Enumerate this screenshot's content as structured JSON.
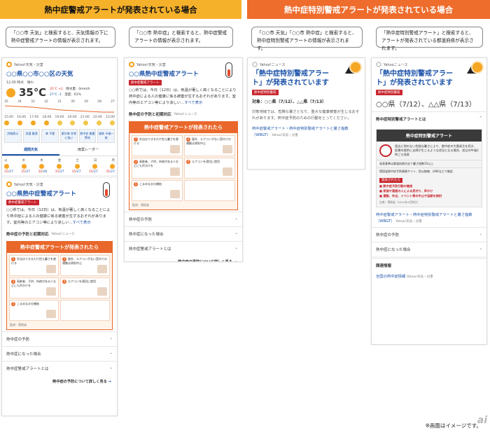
{
  "headers": {
    "left": "熱中症警戒アラートが発表されている場合",
    "right": "熱中症特別警戒アラートが発表されている場合"
  },
  "notes": {
    "n1": "「○○市 天気」と検索すると、天気情報の下に熱中症警戒アラートの情報が表示されます。",
    "n2": "「○○市 熱中症」と検索すると、熱中症警戒アラートの情報が表示されます。",
    "n3": "「○○市 天気」「○○市 熱中症」と検索すると、熱中症特別警戒アラートの情報が表示されます。",
    "n4": "「熱中症特別警戒アラート」と検索すると、アラートが発表されている都道府県が表示されます。"
  },
  "card1": {
    "source": "Yahoo!天気・災害",
    "title": "○○県○○市○○区の天気",
    "date": "12:00 時点　晴れ",
    "temp": "35℃",
    "hi": "35℃ +2",
    "lo": "27℃ -1",
    "rain": "降水量：0mm/h",
    "hum": "湿度：61%",
    "scale": [
      "35",
      "34",
      "33",
      "32",
      "31",
      "30",
      "29",
      "28",
      "27"
    ],
    "hours": [
      "15:00",
      "16:00",
      "17:00",
      "18:00",
      "19:00",
      "20:00",
      "21:00",
      "22:00",
      "23:00"
    ],
    "buttons": [
      "詳細表示",
      "洗濯 最適",
      "傘 不要",
      "紫外線 非常に強い",
      "熱中症 厳重警戒",
      "服装 半袖一枚"
    ],
    "tab1": "週間天気",
    "tab2": "雨雲レーダー",
    "days": [
      "火",
      "水",
      "木",
      "金",
      "土",
      "日",
      "月"
    ],
    "highs": [
      "35",
      "35",
      "34",
      "35",
      "35",
      "35",
      "35"
    ],
    "lows": [
      "27",
      "27",
      "26",
      "27",
      "27",
      "27",
      "27"
    ]
  },
  "alert": {
    "source": "Yahoo!天気・災害",
    "title": "○○県熱中症警戒アラート",
    "badge": "熱中症警戒アラート",
    "body": "○○県では、今日（12日）は、気温が著しく高くなることにより熱中症による人の健康に係る被害が生ずるおそれがあります。室内等のエアコン等により涼しい…",
    "more": "すべて表示",
    "sec": "熱中症の予防と初期対応",
    "secsub": "Yahoo!ニュース",
    "orangeTitle": "熱中症警戒アラートが発表されたら",
    "cells": [
      "外出はできるだけ控え暑さを避ける",
      "屋外、エアコンがない室内での運動は原則中止",
      "高齢者、子供、持病がある人などにも声かけを",
      "エアコンを適切に使用",
      "こまめな水分補給"
    ],
    "credit": "監修：環境省",
    "acc": [
      "熱中症の予防",
      "熱中症になった場合",
      "熱中症警戒アラートとは"
    ],
    "moreLink": "熱中症の予防について詳しく見る"
  },
  "card3": {
    "source": "Yahoo!ニュース",
    "title": "「熱中症特別警戒アラート」が発表されています",
    "badge": "熱中症特別警戒",
    "target": "対象：○○県（7/12）、△△県（7/13）",
    "body": "対象地域では、危険な暑さとなり、重大な健康被害が生じるおそれがあります。熱中症予防のための行動をとってください。",
    "link": "熱中症警戒アラート・熱中症特別警戒アラートと暑さ指数（WBGT）",
    "linksrc": "Yahoo!天気・災害"
  },
  "card4": {
    "source": "Yahooニュース",
    "title": "「熱中症特別警戒アラート」が発表されています",
    "badge": "熱中症特別警戒",
    "big": "○○県（7/12）、△△県（7/13）",
    "acc1": "熱中症特別警戒アラートとは",
    "darkTitle": "熱中症特別警戒アラート",
    "darkText": "過去に例のない危険な暑さにより、熱中症の大量発生を招き、医療の提供に支障が生じるような状況となる場合、前日の午後2時ごろ発表",
    "darkBul1": "発表基準は都道府県内全て暑さ指数35以上",
    "darkBul2": "環境省熱中症予防情報サイト、防災無線、LINEなどで確認",
    "darkLabel": "発表されたら",
    "darkList": [
      "熱中症予防行動の徹底",
      "家族や周囲の人による見守り、声かけ",
      "運動、外出、イベント等の中止や延期を検討"
    ],
    "darkSrc": "出典：環境省（2024年4月時点）",
    "link": "熱中症警戒アラート・熱中症特別警戒アラートと暑さ指数（WBGT）",
    "linksrc": "Yahoo!天気・災害",
    "acc2": "熱中症の予防",
    "acc3": "熱中症になった場合",
    "relTitle": "関連情報",
    "relLink": "全国の熱中症情報",
    "relSrc": "Yahoo!天気・災害"
  },
  "footer": "※画面はイメージです。"
}
